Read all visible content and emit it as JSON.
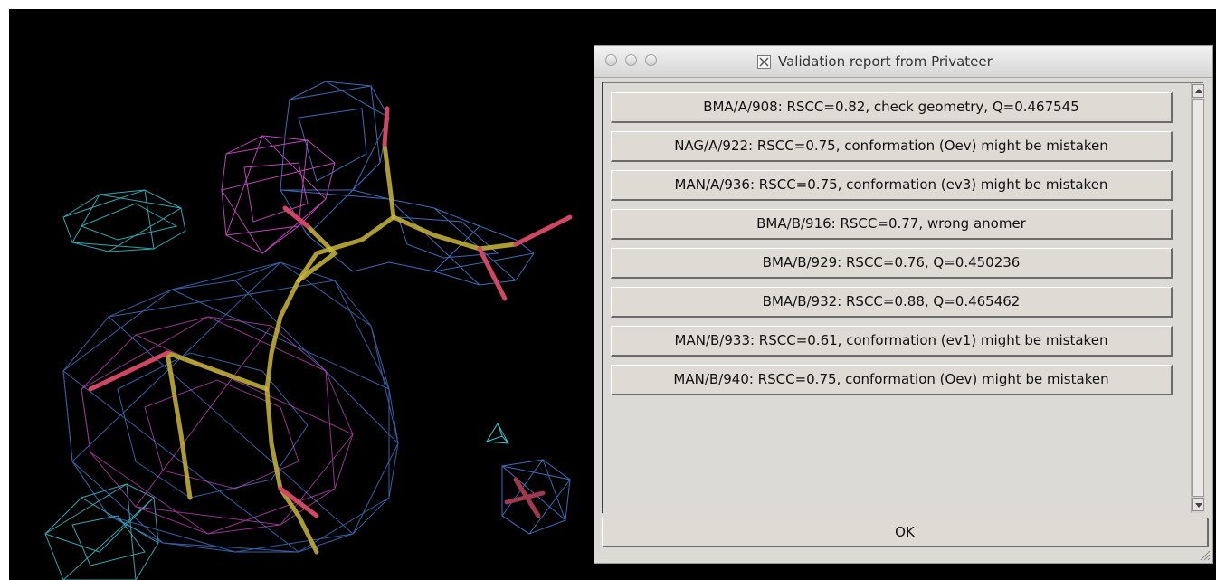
{
  "dialog": {
    "title": "Validation report from Privateer",
    "report_items": [
      "BMA/A/908: RSCC=0.82, check geometry, Q=0.467545",
      "NAG/A/922: RSCC=0.75, conformation (Oev) might be mistaken",
      "MAN/A/936: RSCC=0.75, conformation (ev3) might be mistaken",
      "BMA/B/916: RSCC=0.77, wrong anomer",
      "BMA/B/929: RSCC=0.76, Q=0.450236",
      "BMA/B/932: RSCC=0.88, Q=0.465462",
      "MAN/B/933: RSCC=0.61, conformation (ev1) might be mistaken",
      "MAN/B/940: RSCC=0.75, conformation (Oev) might be mistaken"
    ],
    "ok_label": "OK",
    "window_buttons": [
      "close-button",
      "minimize-button",
      "zoom-button"
    ],
    "title_icon": "x11-icon"
  },
  "viewport": {
    "background": "#000000",
    "mesh_colors": {
      "blue": "#4a7fd8",
      "magenta": "#cf4ec8",
      "cyan": "#3cc4cc",
      "bond_yellow": "#c9b63a",
      "bond_red": "#d04664"
    }
  }
}
